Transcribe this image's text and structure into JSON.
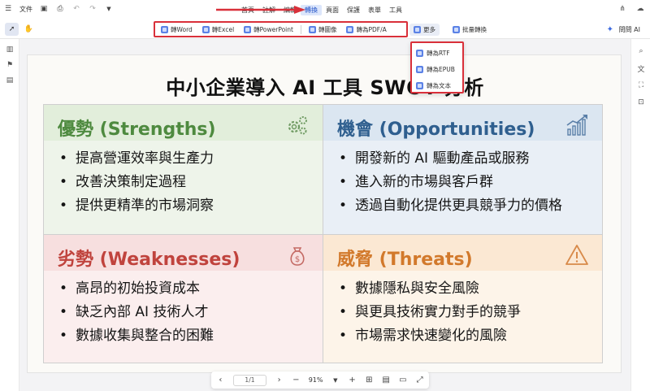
{
  "topbar": {
    "file_label": "文件",
    "menu": [
      "首頁",
      "註解",
      "編輯",
      "轉換",
      "頁面",
      "保護",
      "表單",
      "工具"
    ],
    "active_menu_index": 3
  },
  "toolbar": {
    "convert_buttons": [
      "轉Word",
      "轉Excel",
      "轉PowerPoint",
      "轉圖像",
      "轉為PDF/A"
    ],
    "more_label": "更多",
    "batch_label": "批量轉換",
    "ai_label": "問問 AI"
  },
  "dropdown": {
    "items": [
      "轉為RTF",
      "轉為EPUB",
      "轉為文本"
    ]
  },
  "document": {
    "title": "中小企業導入 AI 工具 SWOT 分析",
    "strengths": {
      "heading": "優勢 (Strengths)",
      "items": [
        "提高營運效率與生產力",
        "改善決策制定過程",
        "提供更精準的市場洞察"
      ]
    },
    "opportunities": {
      "heading": "機會 (Opportunities)",
      "items": [
        "開發新的 AI 驅動產品或服務",
        "進入新的市場與客戶群",
        "透過自動化提供更具競爭力的價格"
      ]
    },
    "weaknesses": {
      "heading": "劣勢 (Weaknesses)",
      "items": [
        "高昂的初始投資成本",
        "缺乏內部 AI 技術人才",
        "數據收集與整合的困難"
      ]
    },
    "threats": {
      "heading": "威脅 (Threats)",
      "items": [
        "數據隱私與安全風險",
        "與更具技術實力對手的競爭",
        "市場需求快速變化的風險"
      ]
    }
  },
  "bottom_nav": {
    "page_indicator": "1/1",
    "zoom": "91%"
  },
  "colors": {
    "highlight_red": "#d9303a",
    "strengths": "#4e8a3f",
    "opportunities": "#2f5f8f",
    "weaknesses": "#c0433d",
    "threats": "#d2792b"
  }
}
